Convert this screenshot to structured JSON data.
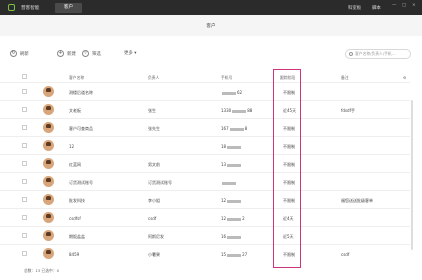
{
  "topbar": {
    "brand": "营客智能",
    "active_tab": "客户",
    "right_links": [
      "科室板",
      "脚本"
    ],
    "window_controls": [
      "—",
      "□",
      "×"
    ]
  },
  "page_title": "客户",
  "toolbar": {
    "refresh": "刷新",
    "add": "新建",
    "filter": "筛选",
    "more": "更多",
    "search_placeholder": "客户名称/负责人/手机..."
  },
  "table": {
    "columns": [
      "客户名称",
      "负责人",
      "手机号",
      "跟踪阶段",
      "备注"
    ],
    "rows": [
      {
        "name": "测楼后道名称",
        "owner": "",
        "phone_pre": "",
        "phone_post": "62",
        "follow": "不限制",
        "note": ""
      },
      {
        "name": "文老板",
        "owner": "张生",
        "phone_pre": "1330",
        "phone_post": "88",
        "follow": "近45天",
        "note": "fdsdf手"
      },
      {
        "name": "客户可查商品",
        "owner": "张先生",
        "phone_pre": "167",
        "phone_post": "8",
        "follow": "不限制",
        "note": ""
      },
      {
        "name": "12",
        "owner": "",
        "phone_pre": "18",
        "phone_post": "",
        "follow": "不限制",
        "note": ""
      },
      {
        "name": "红蓝网",
        "owner": "男文前",
        "phone_pre": "13",
        "phone_post": "",
        "follow": "不限制",
        "note": ""
      },
      {
        "name": "订货测试账号",
        "owner": "订货测试账号",
        "phone_pre": "",
        "phone_post": "",
        "follow": "不限制",
        "note": ""
      },
      {
        "name": "批发科技",
        "owner": "李小姐",
        "phone_pre": "12",
        "phone_post": "",
        "follow": "不限制",
        "note": "福您送送批级客单"
      },
      {
        "name": "csdfsf",
        "owner": "csdf",
        "phone_pre": "12",
        "phone_post": "2",
        "follow": "近4天",
        "note": ""
      },
      {
        "name": "期饭盐盐",
        "owner": "阿斯尼发",
        "phone_pre": "16",
        "phone_post": "",
        "follow": "近5天",
        "note": ""
      },
      {
        "name": "8459",
        "owner": "小薯果",
        "phone_pre": "15",
        "phone_post": "27",
        "follow": "不限制",
        "note": "csdf"
      }
    ]
  },
  "footer": "总数：13  已选中：0"
}
